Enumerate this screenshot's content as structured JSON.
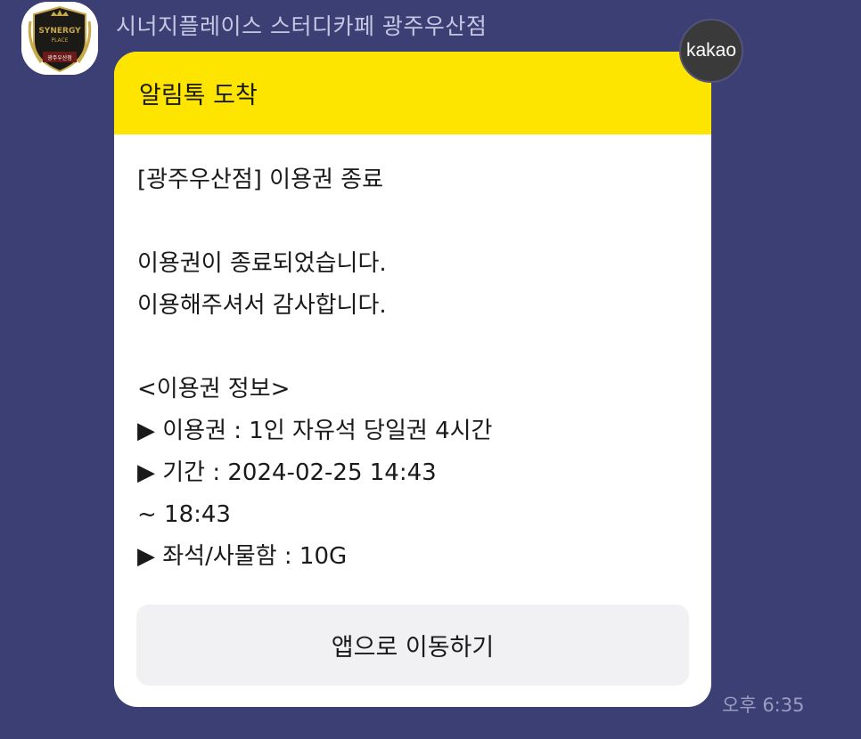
{
  "chat": {
    "sender_name": "시너지플레이스 스터디카페 광주우산점",
    "avatar_logo_top": "SYNERGY",
    "avatar_logo_mid": "PLACE",
    "avatar_logo_bottom": "광주우산점",
    "badge": "kakao",
    "timestamp": "오후 6:35"
  },
  "message": {
    "header": "알림톡 도착",
    "lines": [
      "[광주우산점] 이용권 종료",
      "",
      "이용권이 종료되었습니다.",
      "이용해주셔서 감사합니다.",
      "",
      "<이용권 정보>",
      "▶ 이용권 : 1인 자유석 당일권 4시간",
      "▶ 기간 : 2024-02-25 14:43",
      "~ 18:43",
      "▶ 좌석/사물함 : 10G"
    ],
    "button_label": "앱으로 이동하기"
  },
  "colors": {
    "background": "#3b3f74",
    "header_yellow": "#fee500",
    "button_gray": "#f1f1f3"
  }
}
